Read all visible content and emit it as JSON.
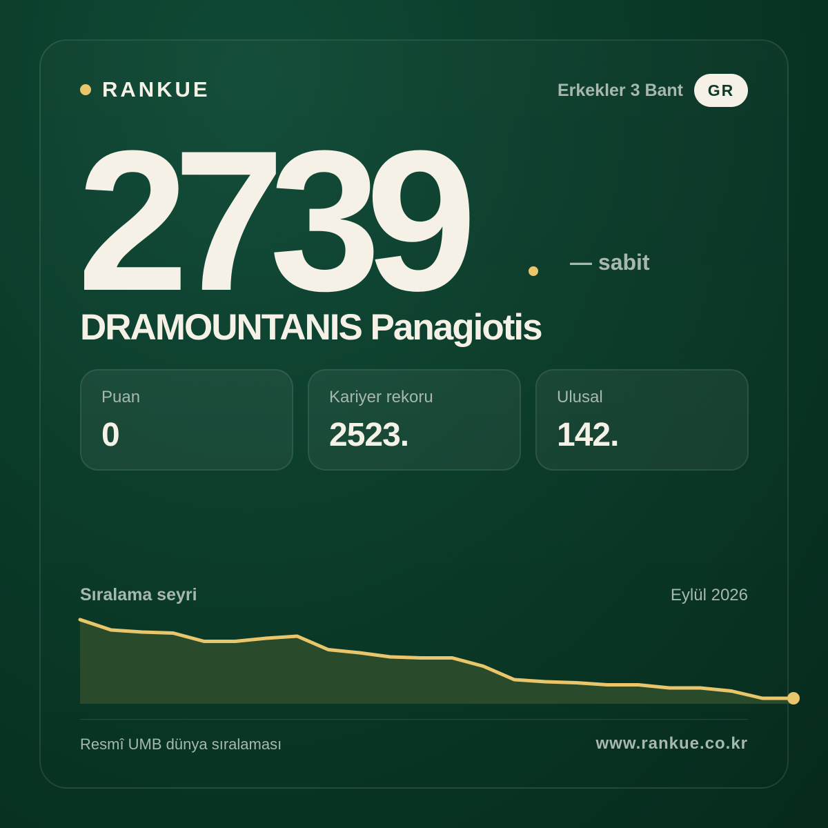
{
  "brand": {
    "name": "RANKUE"
  },
  "header": {
    "division": "Erkekler 3 Bant",
    "country_code": "GR"
  },
  "ranking": {
    "rank": "2739",
    "trend": "— sabit"
  },
  "player": {
    "name": "DRAMOUNTANIS Panagiotis"
  },
  "stats": [
    {
      "label": "Puan",
      "value": "0"
    },
    {
      "label": "Kariyer rekoru",
      "value": "2523."
    },
    {
      "label": "Ulusal",
      "value": "142."
    }
  ],
  "chart_section": {
    "title": "Sıralama seyri",
    "date": "Eylül 2026"
  },
  "chart_data": {
    "type": "area",
    "title": "Sıralama seyri",
    "y_inverted": true,
    "values": [
      2400,
      2450,
      2460,
      2465,
      2505,
      2505,
      2490,
      2480,
      2545,
      2560,
      2580,
      2585,
      2585,
      2625,
      2690,
      2700,
      2705,
      2715,
      2715,
      2730,
      2730,
      2745,
      2780,
      2780
    ],
    "series_color": "#e9c66b",
    "fill_color": "#2a4a2c"
  },
  "footer": {
    "source": "Resmî UMB dünya sıralaması",
    "url": "www.rankue.co.kr"
  },
  "colors": {
    "accent": "#e9c66b",
    "text": "#f5f1e6",
    "muted": "#a7b8ad",
    "background": "#0a3a28"
  }
}
